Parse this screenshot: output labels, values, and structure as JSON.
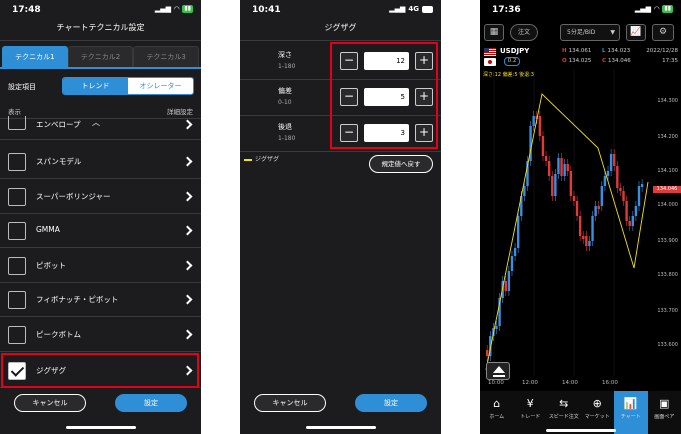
{
  "panel1": {
    "time": "17:48",
    "title": "チャートテクニカル設定",
    "tabs": [
      "テクニカル1",
      "テクニカル2",
      "テクニカル3"
    ],
    "setting_label": "設定項目",
    "segments": [
      "トレンド",
      "オシレーター"
    ],
    "header_left": "表示",
    "header_right": "詳細設定",
    "items": [
      {
        "label": "エンベロープ",
        "checked": false
      },
      {
        "label": "スパンモデル",
        "checked": false
      },
      {
        "label": "スーパーボリンジャー",
        "checked": false
      },
      {
        "label": "GMMA",
        "checked": false
      },
      {
        "label": "ピボット",
        "checked": false
      },
      {
        "label": "フィボナッチ・ピボット",
        "checked": false
      },
      {
        "label": "ピークボトム",
        "checked": false
      },
      {
        "label": "ジグザグ",
        "checked": true
      }
    ],
    "cancel_label": "キャンセル",
    "ok_label": "設定"
  },
  "panel2": {
    "time": "10:41",
    "network": "4G",
    "title": "ジグザグ",
    "params": [
      {
        "name": "深さ",
        "range": "1-180",
        "value": "12"
      },
      {
        "name": "偏差",
        "range": "0-10",
        "value": "5"
      },
      {
        "name": "後退",
        "range": "1-180",
        "value": "3"
      }
    ],
    "legend_label": "ジグザグ",
    "reset_label": "規定値へ戻す",
    "cancel_label": "キャンセル",
    "ok_label": "設定"
  },
  "panel3": {
    "time": "17:36",
    "order_label": "注文",
    "timeframe": "5分足/BID",
    "symbol": "USDJPY",
    "spread": "0.2",
    "high_label": "H",
    "high": "134.061",
    "low_label": "L",
    "low": "134.023",
    "open_label": "O",
    "open": "134.025",
    "close_label": "C",
    "close": "134.046",
    "date": "2022/12/28",
    "clock": "17:35",
    "indicator_label": "深さ:12 偏差:5 後退:3",
    "y_ticks": [
      "134.300",
      "134.200",
      "134.100",
      "134.000",
      "133.900",
      "133.800",
      "133.700",
      "133.600"
    ],
    "price_tag": "134.046",
    "x_ticks": [
      "10:00",
      "12:00",
      "14:00",
      "16:00"
    ],
    "nav": [
      {
        "label": "ホーム",
        "icon": "home-icon"
      },
      {
        "label": "トレード",
        "icon": "trade-icon"
      },
      {
        "label": "スピード注文",
        "icon": "speed-order-icon"
      },
      {
        "label": "マーケット",
        "icon": "market-icon"
      },
      {
        "label": "チャート",
        "icon": "chart-icon"
      },
      {
        "label": "画面ペア",
        "icon": "screen-pair-icon"
      }
    ],
    "colors": {
      "up": "#3b8fe0",
      "down": "#e03a3a",
      "zigzag": "#f5e21a",
      "accent": "#2e8fd6"
    }
  }
}
